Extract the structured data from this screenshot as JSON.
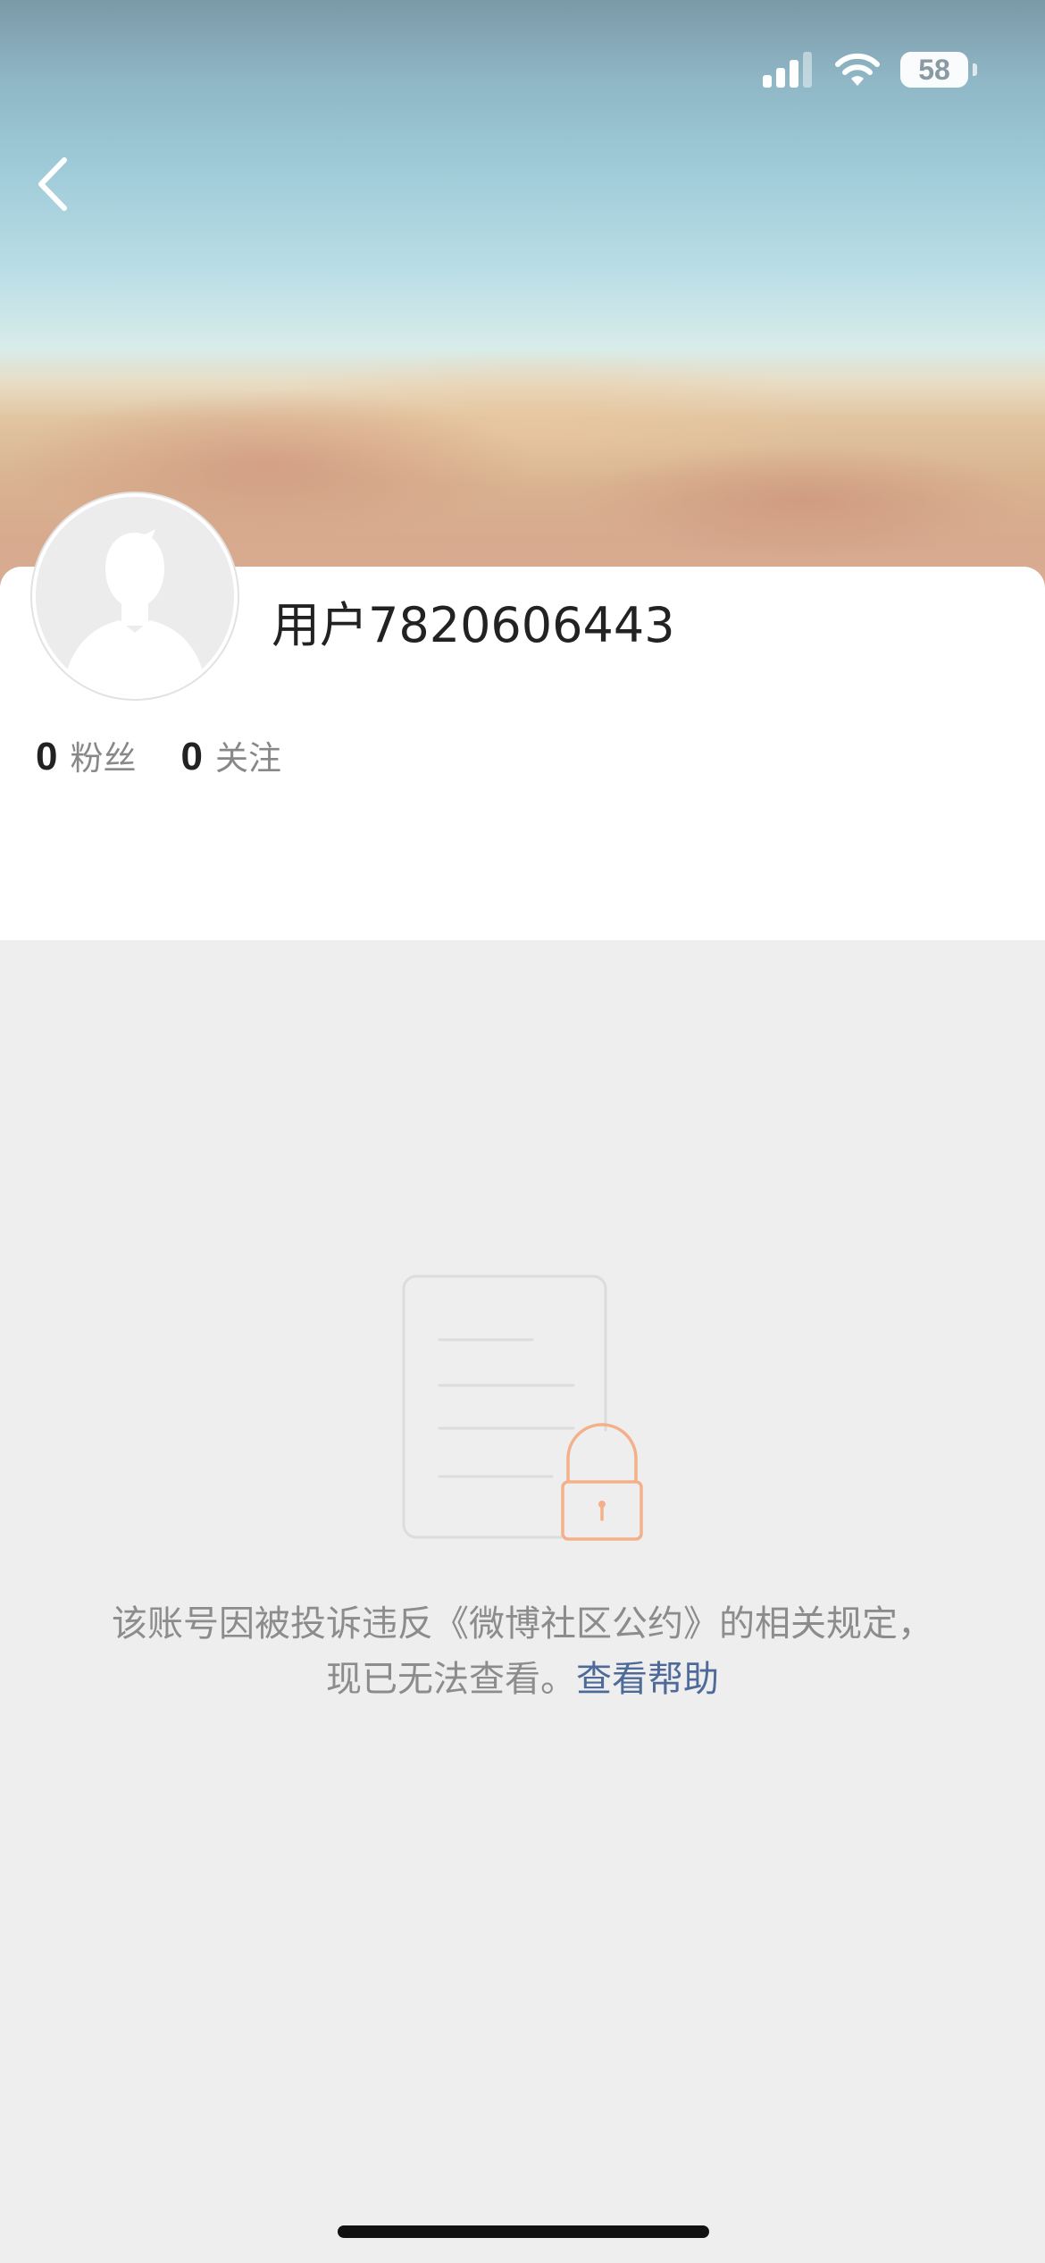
{
  "status_bar": {
    "battery_level": "58"
  },
  "navigation": {
    "back_icon": "chevron-left-icon"
  },
  "profile": {
    "username": "用户7820606443",
    "avatar_icon": "default-avatar-icon",
    "stats": [
      {
        "count": "0",
        "label": "粉丝"
      },
      {
        "count": "0",
        "label": "关注"
      }
    ]
  },
  "empty_state": {
    "icon": "locked-document-icon",
    "message": "该账号因被投诉违反《微博社区公约》的相关规定，现已无法查看。",
    "help_link": "查看帮助"
  },
  "colors": {
    "lock_accent": "#f3b08a",
    "link": "#4e6a99",
    "page_background": "#eeeeee"
  }
}
